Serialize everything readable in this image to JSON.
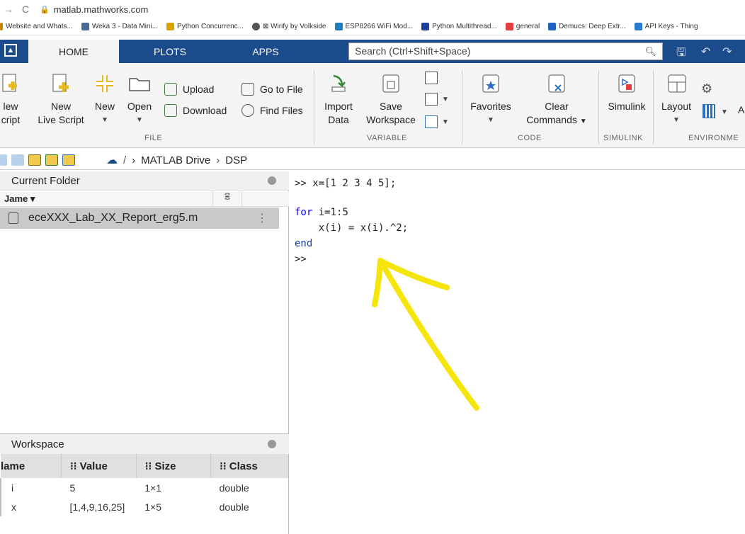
{
  "browser": {
    "url": "matlab.mathworks.com",
    "bookmarks": [
      {
        "label": "Website and Whats...",
        "color": "#c88400"
      },
      {
        "label": "Weka 3 - Data Mini...",
        "color": "#4a6a9a"
      },
      {
        "label": "Python Concurrenc...",
        "color": "#d9a400"
      },
      {
        "label": "⊠ Wirify by Volkside",
        "color": "#555555"
      },
      {
        "label": "ESP8266 WiFi Mod...",
        "color": "#1b7fbf"
      },
      {
        "label": "Python Multithread...",
        "color": "#1e3fa0"
      },
      {
        "label": "general",
        "color": "#e04040"
      },
      {
        "label": "Demucs: Deep Extr...",
        "color": "#1e5fbf"
      },
      {
        "label": "API Keys - Thing",
        "color": "#2a7ad0"
      }
    ]
  },
  "tabs": {
    "home": "HOME",
    "plots": "PLOTS",
    "apps": "APPS"
  },
  "search": {
    "placeholder": "Search (Ctrl+Shift+Space)"
  },
  "ribbon": {
    "new_script": [
      "lew",
      "cript"
    ],
    "new_live_script": [
      "New",
      "Live Script"
    ],
    "new": "New",
    "open": "Open",
    "upload": "Upload",
    "download": "Download",
    "go_to_file": "Go to File",
    "find_files": "Find Files",
    "import_data": [
      "Import",
      "Data"
    ],
    "save_workspace": [
      "Save",
      "Workspace"
    ],
    "favorites": "Favorites",
    "clear_commands": [
      "Clear",
      "Commands"
    ],
    "simulink": "Simulink",
    "layout": "Layout",
    "layout_more": "A",
    "sections": {
      "file": "FILE",
      "variable": "VARIABLE",
      "code": "CODE",
      "simulink": "SIMULINK",
      "environment": "ENVIRONME"
    }
  },
  "path": {
    "sep": "/",
    "crumbs": [
      "MATLAB Drive",
      "DSP"
    ]
  },
  "current_folder": {
    "title": "Current Folder",
    "name_header": "Jame ▾",
    "file": "eceXXX_Lab_XX_Report_erg5.m"
  },
  "workspace": {
    "title": "Workspace",
    "headers": [
      "lame",
      "⁝⁝ Value",
      "⁝⁝ Size",
      "⁝⁝ Class"
    ],
    "rows": [
      {
        "name": "i",
        "value": "5",
        "size": "1×1",
        "class": "double"
      },
      {
        "name": "x",
        "value": "[1,4,9,16,25]",
        "size": "1×5",
        "class": "double"
      }
    ]
  },
  "command_window": {
    "line1": ">> x=[1 2 3 4 5];",
    "line2_kw": "for",
    "line2_rest": " i=1:5",
    "line3": "    x(i) = x(i).^2;",
    "line4_kw": "end",
    "line5": ">>"
  },
  "colors": {
    "tabstrip": "#1c4b8c",
    "annotation_arrow": "#f5e50a"
  }
}
